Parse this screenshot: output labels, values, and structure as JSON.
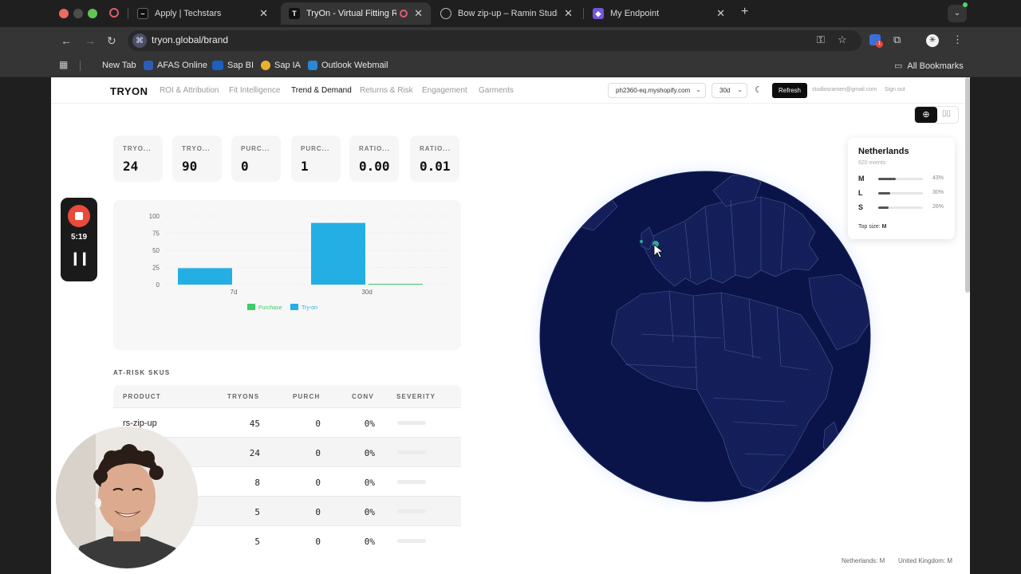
{
  "browser": {
    "tabs": [
      {
        "label": "Apply | Techstars",
        "active": false
      },
      {
        "label": "TryOn - Virtual Fitting Room",
        "active": true
      },
      {
        "label": "Bow zip-up – Ramin Studios",
        "active": false
      },
      {
        "label": "My Endpoint",
        "active": false
      }
    ],
    "url": "tryon.global/brand",
    "bookmarks": [
      "New Tab",
      "AFAS Online",
      "Sap BI",
      "Sap IA",
      "Outlook Webmail"
    ],
    "all_bookmarks": "All Bookmarks",
    "extension_badge": "1"
  },
  "app": {
    "logo": "TRYON",
    "nav": [
      "ROI & Attribution",
      "Fit Intelligence",
      "Trend & Demand",
      "Returns & Risk",
      "Engagement",
      "Garments"
    ],
    "active_nav": "Trend & Demand",
    "shop": "ph2360-eq.myshopify.com",
    "period": "30d",
    "refresh_label": "Refresh",
    "email": "studiosramen@gmail.com",
    "signout_label": "Sign out"
  },
  "kpis": [
    {
      "label": "TRYO...",
      "value": "24"
    },
    {
      "label": "TRYO...",
      "value": "90"
    },
    {
      "label": "PURC...",
      "value": "0"
    },
    {
      "label": "PURC...",
      "value": "1"
    },
    {
      "label": "RATIO...",
      "value": "0.00"
    },
    {
      "label": "RATIO...",
      "value": "0.01"
    }
  ],
  "chart_data": {
    "type": "bar",
    "categories": [
      "7d",
      "30d"
    ],
    "series": [
      {
        "name": "Try-on",
        "values": [
          24,
          90
        ],
        "color": "#23afe3"
      },
      {
        "name": "Purchase",
        "values": [
          0,
          1
        ],
        "color": "#3ccc6a"
      }
    ],
    "ylim": [
      0,
      100
    ],
    "yticks": [
      "100",
      "75",
      "50",
      "25",
      "0"
    ],
    "legend_position": "bottom",
    "grid": true
  },
  "at_risk": {
    "title": "AT-RISK SKUS",
    "headers": [
      "PRODUCT",
      "TRYONS",
      "PURCH",
      "CONV",
      "SEVERITY"
    ],
    "rows": [
      {
        "product": "rs-zip-up",
        "tryons": "45",
        "purch": "0",
        "conv": "0%"
      },
      {
        "product": "",
        "tryons": "24",
        "purch": "0",
        "conv": "0%"
      },
      {
        "product": "",
        "tryons": "8",
        "purch": "0",
        "conv": "0%"
      },
      {
        "product": "",
        "tryons": "5",
        "purch": "0",
        "conv": "0%"
      },
      {
        "product": "",
        "tryons": "5",
        "purch": "0",
        "conv": "0%"
      }
    ]
  },
  "tooltip": {
    "country": "Netherlands",
    "events": "620 events",
    "sizes": [
      {
        "size": "M",
        "pct": "43%",
        "fraction": 0.43
      },
      {
        "size": "L",
        "pct": "30%",
        "fraction": 0.3
      },
      {
        "size": "S",
        "pct": "26%",
        "fraction": 0.26
      }
    ],
    "top_size_label": "Top size:",
    "top_size": "M"
  },
  "footer": {
    "left": "Netherlands: M",
    "right": "United Kingdom: M"
  },
  "recorder": {
    "time": "5:19"
  },
  "colors": {
    "globe_ocean": "#0b1448",
    "globe_outline": "#3e4c87",
    "accent_tryon": "#23afe3",
    "accent_purchase": "#3ccc6a"
  }
}
